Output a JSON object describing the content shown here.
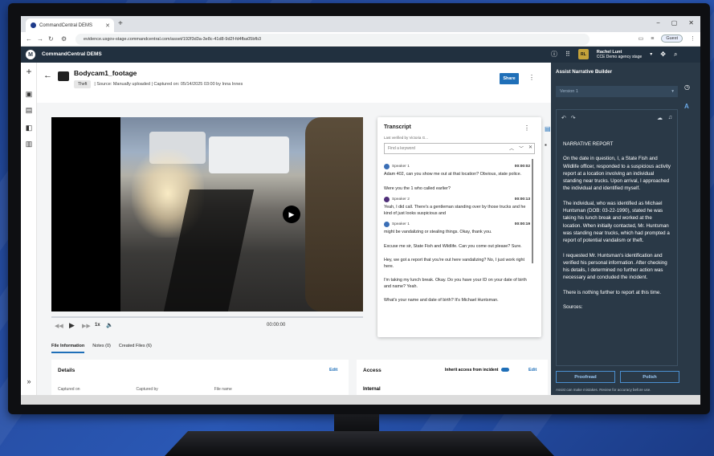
{
  "browser": {
    "tab_title": "CommandCentral DEMS",
    "tab_close": "✕",
    "new_tab": "+",
    "url": "evidence.usgov-stage.commandcentral.com/asset/192f3d3a-3e8c-41d8-9d2f-fd4fba05bfb3",
    "guest_label": "Guest",
    "win_min": "−",
    "win_max": "▢",
    "win_close": "✕"
  },
  "app": {
    "name": "CommandCentral DEMS",
    "logo": "M",
    "user_initials": "RL",
    "user_name": "Rachel Lunt",
    "user_agency": "CCE Demo agency stage"
  },
  "asset": {
    "title": "Bodycam1_footage",
    "tag": "Theft",
    "source": "| Source: Manually uploaded | Captured on: 05/14/2025 03:00 by Inna Innes",
    "share_label": "Share"
  },
  "player": {
    "time": "00:00:00",
    "speed": "1x"
  },
  "tabs": [
    {
      "label": "File Information"
    },
    {
      "label": "Notes (0)"
    },
    {
      "label": "Created Files (6)"
    }
  ],
  "details": {
    "title": "Details",
    "edit": "Edit",
    "captured_on": "Captured on",
    "captured_by": "Captured by",
    "file_name": "File name"
  },
  "access": {
    "title": "Access",
    "inherit": "Inherit access from incident",
    "edit": "Edit",
    "internal": "Internal"
  },
  "transcript": {
    "title": "Transcript",
    "last_verified": "Last verified by Victoria G...",
    "search_placeholder": "Find a keyword",
    "entries": [
      {
        "speaker": "Speaker 1",
        "time": "00:00:02",
        "lines": [
          "Adam 402, can you show me out at that location? Obvious, state police.",
          "Were you the 1 who called earlier?"
        ]
      },
      {
        "speaker": "Speaker 2",
        "time": "00:00:13",
        "lines": [
          "Yeah, I did call. There's a gentleman standing over by those trucks and he kind of just looks suspicious and"
        ]
      },
      {
        "speaker": "Speaker 1",
        "time": "00:00:19",
        "lines": [
          "might be vandalizing or stealing things. Okay, thank you.",
          "Excuse me sir, State Fish and Wildlife. Can you come out please? Sure.",
          "Hey, we got a report that you're out here vandalizing? No, I just work right here.",
          "I'm taking my lunch break. Okay. Do you have your ID on your date of birth and name? Yeah.",
          "What's your name and date of birth? It's Michael Huntsman."
        ]
      }
    ]
  },
  "narrative": {
    "panel_title": "Assist Narrative Builder",
    "version": "Version 1",
    "heading": "NARRATIVE REPORT",
    "paragraphs": [
      "On the date in question, I, a State Fish and Wildlife officer, responded to a suspicious activity report at a location involving an individual standing near trucks. Upon arrival, I approached the individual and identified myself.",
      "The individual, who was identified as Michael Huntsman (DOB: 03-22-1990), stated he was taking his lunch break and worked at the location. When initially contacted, Mr. Huntsman was standing near trucks, which had prompted a report of potential vandalism or theft.",
      "I requested Mr. Huntsman's identification and verified his personal information. After checking his details, I determined no further action was necessary and concluded the incident.",
      "There is nothing further to report at this time.",
      "Sources:"
    ],
    "proofread": "Proofread",
    "polish": "Polish",
    "disclaimer": "Assist can make mistakes. Review for accuracy before use."
  },
  "colors": {
    "accent": "#1f6fb8",
    "header": "#21303f",
    "narrative_bg": "#2a3947"
  }
}
